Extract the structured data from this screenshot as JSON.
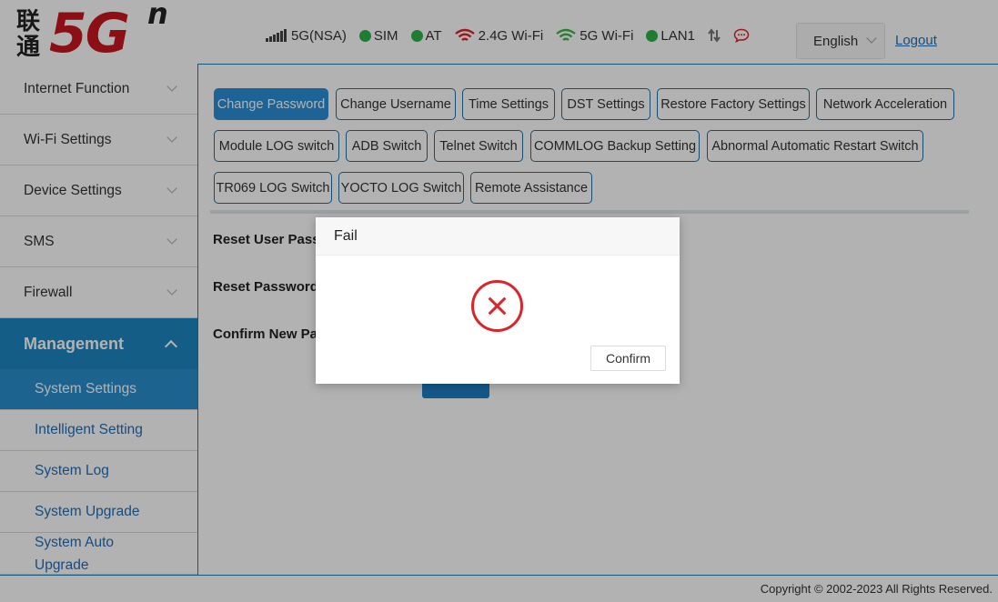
{
  "header": {
    "logo_chars": "联通",
    "logo_main": "5G",
    "logo_sup": "n",
    "status": [
      {
        "name": "network",
        "label": "5G(NSA)"
      },
      {
        "name": "sim",
        "label": "SIM"
      },
      {
        "name": "at",
        "label": "AT"
      },
      {
        "name": "wifi24",
        "label": "2.4G Wi-Fi"
      },
      {
        "name": "wifi5",
        "label": "5G Wi-Fi"
      },
      {
        "name": "lan1",
        "label": "LAN1"
      }
    ],
    "language": "English",
    "logout": "Logout"
  },
  "sidebar": {
    "menus": [
      {
        "label": "Internet Function"
      },
      {
        "label": "Wi-Fi Settings"
      },
      {
        "label": "Device Settings"
      },
      {
        "label": "SMS"
      },
      {
        "label": "Firewall"
      }
    ],
    "active_menu": "Management",
    "sub_items": [
      {
        "label": "System Settings"
      },
      {
        "label": "Intelligent Setting"
      },
      {
        "label": "System Log"
      },
      {
        "label": "System Upgrade"
      },
      {
        "label": "System Auto Upgrade"
      }
    ]
  },
  "tabs": [
    {
      "label": "Change Password"
    },
    {
      "label": "Change Username"
    },
    {
      "label": "Time Settings"
    },
    {
      "label": "DST Settings"
    },
    {
      "label": "Restore Factory Settings"
    },
    {
      "label": "Network Acceleration"
    },
    {
      "label": "Module LOG switch"
    },
    {
      "label": "ADB Switch"
    },
    {
      "label": "Telnet Switch"
    },
    {
      "label": "COMMLOG Backup Setting"
    },
    {
      "label": "Abnormal Automatic Restart Switch"
    },
    {
      "label": "TR069 LOG Switch"
    },
    {
      "label": "YOCTO LOG Switch"
    },
    {
      "label": "Remote Assistance"
    }
  ],
  "form": {
    "reset_user_password": "Reset User Passw",
    "reset_password": "Reset Password:",
    "confirm_new_password": "Confirm New Pa"
  },
  "dialog": {
    "title": "Fail",
    "confirm": "Confirm"
  },
  "footer": {
    "copyright": "Copyright © 2002-2023 All Rights Reserved."
  },
  "colors": {
    "brand_red": "#c8161d",
    "accent_blue": "#1e86c2",
    "status_green": "#2db34a",
    "wifi24_red": "#d9262a",
    "error_red": "#d9262a"
  }
}
